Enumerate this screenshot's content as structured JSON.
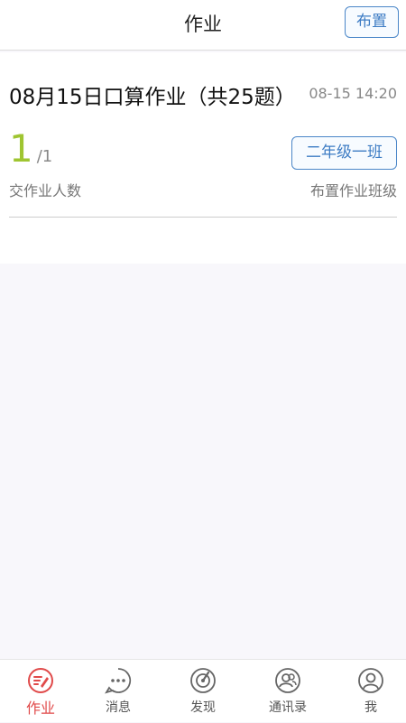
{
  "header": {
    "title": "作业",
    "publish_label": "布置"
  },
  "homework": {
    "title": "08月15日口算作业（共25题）",
    "time": "08-15 14:20",
    "submitted_count": "1",
    "total_count": "/1",
    "submitted_label": "交作业人数",
    "class_name": "二年级一班",
    "class_label": "布置作业班级"
  },
  "tabs": [
    {
      "label": "作业",
      "icon": "homework-icon",
      "active": true
    },
    {
      "label": "消息",
      "icon": "message-icon",
      "active": false
    },
    {
      "label": "发现",
      "icon": "discover-icon",
      "active": false
    },
    {
      "label": "通讯录",
      "icon": "contacts-icon",
      "active": false
    },
    {
      "label": "我",
      "icon": "profile-icon",
      "active": false
    }
  ],
  "colors": {
    "accent_blue": "#3d7cc4",
    "count_green": "#9fc531",
    "active_red": "#e04a4a"
  }
}
